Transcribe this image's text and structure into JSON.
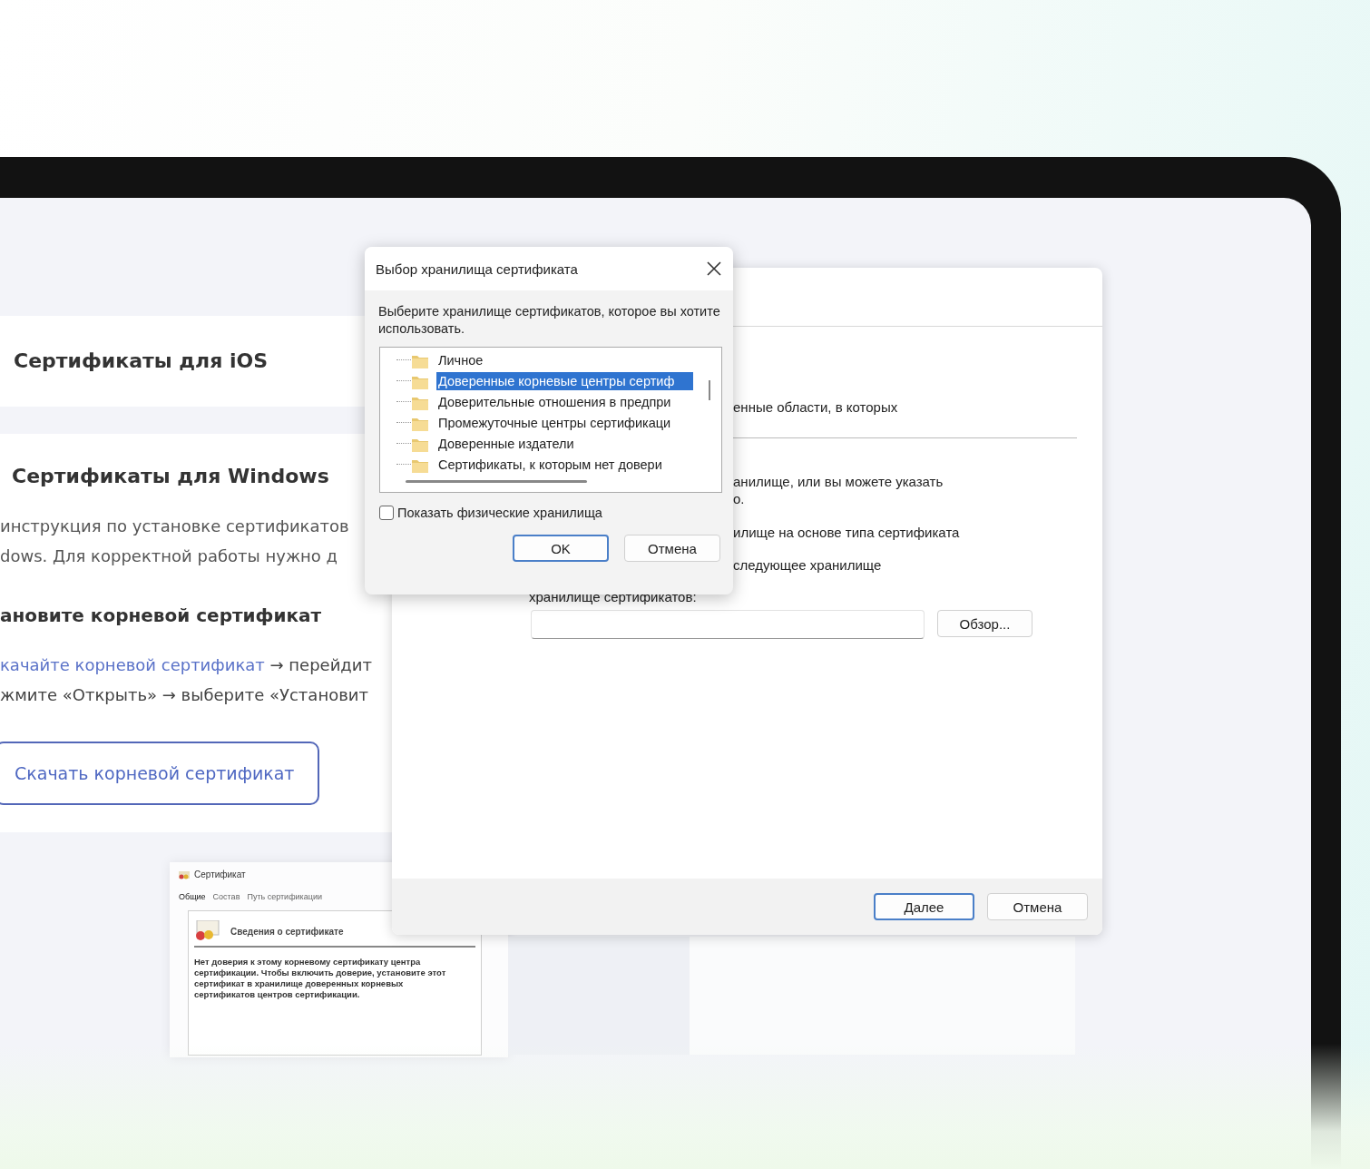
{
  "ios_section": {
    "title": "Сертификаты для iOS"
  },
  "windows_section": {
    "title": "Сертификаты для Windows",
    "paragraph_lines": [
      "инструкция по установке сертификатов",
      "dows. Для корректной работы нужно д"
    ],
    "step_heading": "ановите корневой сертификат",
    "step_lines": [
      {
        "link": "качайте корневой сертификат",
        "text": "→ перейдит"
      },
      {
        "text": "жмите «Открыть» → выберите «Установит"
      }
    ],
    "download_button": "Скачать корневой сертификат"
  },
  "certificate_screenshot": {
    "window_title": "Сертификат",
    "tabs": [
      {
        "label": "Общие",
        "selected": true
      },
      {
        "label": "Состав",
        "selected": false
      },
      {
        "label": "Путь сертификации",
        "selected": false
      }
    ],
    "section_title": "Сведения о сертификате",
    "message": "Нет доверия к этому корневому сертификату центра сертификации. Чтобы включить доверие, установите этот сертификат в хранилище доверенных корневых сертификатов центров сертификации."
  },
  "import_wizard": {
    "text_fragments": [
      "енные области, в которых",
      "анилище, или вы можете указать",
      "о.",
      "илище на основе типа сертификата",
      "следующее хранилище"
    ],
    "store_label": "хранилище сертификатов:",
    "browse_button": "Обзор...",
    "buttons": [
      {
        "label": "Далее",
        "default": true
      },
      {
        "label": "Отмена",
        "default": false
      }
    ]
  },
  "store_dialog": {
    "title": "Выбор хранилища сертификата",
    "instruction": "Выберите хранилище сертификатов, которое вы хотите использовать.",
    "stores": [
      {
        "label": "Личное",
        "selected": false
      },
      {
        "label": "Доверенные корневые центры сертиф",
        "selected": true
      },
      {
        "label": "Доверительные отношения в предпри",
        "selected": false
      },
      {
        "label": "Промежуточные центры сертификаци",
        "selected": false
      },
      {
        "label": "Доверенные издатели",
        "selected": false
      },
      {
        "label": "Сертификаты, к которым нет довери",
        "selected": false
      }
    ],
    "show_physical": {
      "label": "Показать физические хранилища",
      "checked": false
    },
    "buttons": [
      {
        "label": "OK",
        "default": true
      },
      {
        "label": "Отмена",
        "default": false
      }
    ]
  }
}
